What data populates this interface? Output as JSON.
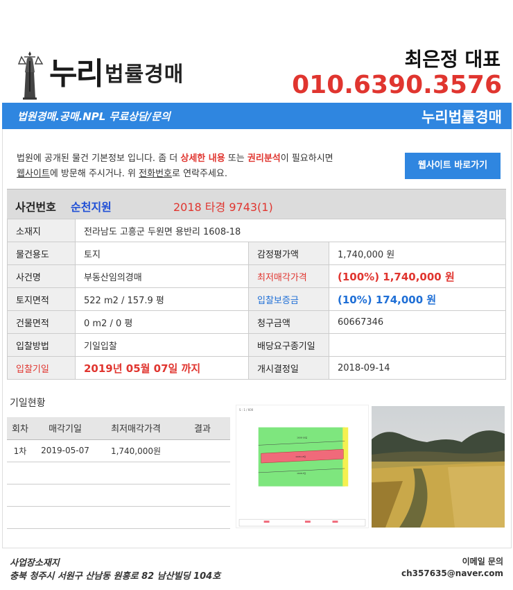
{
  "header": {
    "logo_main": "누리",
    "logo_sub": "법률경매",
    "rep_name": "최은정 대표",
    "rep_phone": "010.6390.3576"
  },
  "banner": {
    "left": "법원경매.공매.NPL 무료상담/문의",
    "right": "누리법률경매"
  },
  "notice": {
    "line1_a": "법원에 공개된 물건 기본정보 입니다. 좀 더 ",
    "line1_b": "상세한 내용",
    "line1_c": " 또는 ",
    "line1_d": "권리분석",
    "line1_e": "이 필요하시면",
    "line2_a": "웹사이트",
    "line2_b": "에 방문해 주시거나. 위 ",
    "line2_c": "전화번호",
    "line2_d": "로 연락주세요.",
    "button": "웹사이트 바로가기"
  },
  "case": {
    "label": "사건번호",
    "court": "순천지원",
    "number": "2018 타경 9743(1)"
  },
  "info": {
    "location_label": "소재지",
    "location": "전라남도 고흥군 두원면 용반리 1608-18",
    "use_label": "물건용도",
    "use": "토지",
    "appraisal_label": "감정평가액",
    "appraisal": "1,740,000 원",
    "case_name_label": "사건명",
    "case_name": "부동산임의경매",
    "min_price_label": "최저매각가격",
    "min_price": "(100%) 1,740,000 원",
    "land_area_label": "토지면적",
    "land_area": "522 m2 / 157.9 평",
    "deposit_label": "입찰보증금",
    "deposit": "(10%) 174,000 원",
    "building_area_label": "건물면적",
    "building_area": "0 m2 / 0 평",
    "claim_label": "청구금액",
    "claim": "60667346",
    "bid_method_label": "입찰방법",
    "bid_method": "기일입찰",
    "dividend_label": "배당요구종기일",
    "dividend": "",
    "bid_date_label": "입찰기일",
    "bid_date": "2019년 05월 07일 까지",
    "start_label": "개시결정일",
    "start": "2018-09-14"
  },
  "history": {
    "title": "기일현황",
    "headers": [
      "회차",
      "매각기일",
      "최저매각가격",
      "결과"
    ],
    "rows": [
      [
        "1차",
        "2019-05-07",
        "1,740,000원",
        ""
      ]
    ]
  },
  "footer": {
    "addr_label": "사업장소재지",
    "addr": "충북 청주시 서원구 산남동 원흥로 82 남산빌딩 104호",
    "email_label": "이메일 문의",
    "email": "ch357635@naver.com"
  },
  "colors": {
    "accent_blue": "#2f86e0",
    "accent_red": "#e0352f"
  }
}
